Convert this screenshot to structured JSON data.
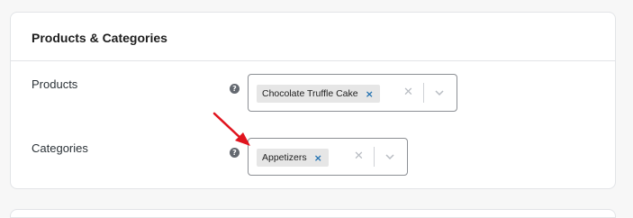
{
  "panel": {
    "title": "Products & Categories"
  },
  "products": {
    "label": "Products",
    "help_icon": "question-circle-icon",
    "selected": [
      "Chocolate Truffle Cake"
    ],
    "remove_symbol": "×",
    "clear_symbol": "✕",
    "dropdown_icon": "chevron-down-icon"
  },
  "categories": {
    "label": "Categories",
    "help_icon": "question-circle-icon",
    "selected": [
      "Appetizers"
    ],
    "remove_symbol": "×",
    "clear_symbol": "✕",
    "dropdown_icon": "chevron-down-icon"
  },
  "help_symbol": "?",
  "annotation": {
    "arrow_color": "#e0141e"
  }
}
